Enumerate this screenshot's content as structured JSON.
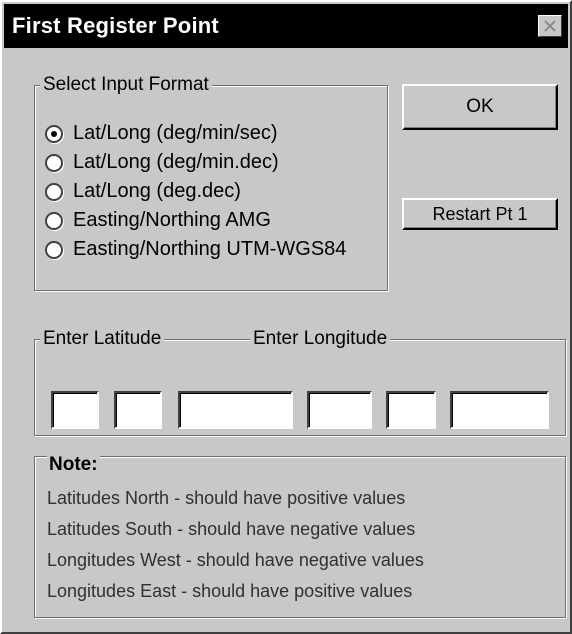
{
  "window": {
    "title": "First Register Point",
    "close_icon": "close-icon"
  },
  "input_format": {
    "legend": "Select Input Format",
    "selected": "Lat/Long (deg/min/sec)",
    "options": [
      "Lat/Long (deg/min/sec)",
      "Lat/Long (deg/min.dec)",
      "Lat/Long (deg.dec)",
      "Easting/Northing AMG",
      "Easting/Northing UTM-WGS84"
    ]
  },
  "buttons": {
    "ok": "OK",
    "restart": "Restart Pt 1"
  },
  "coordinates": {
    "latitude_label": "Enter Latitude",
    "longitude_label": "Enter Longitude",
    "latitude_values": [
      "",
      "",
      ""
    ],
    "longitude_values": [
      "",
      "",
      ""
    ]
  },
  "note": {
    "title": "Note:",
    "lines": [
      "Latitudes North - should have positive values",
      "Latitudes South - should have negative values",
      "Longitudes West - should have negative values",
      "Longitudes East - should have positive values"
    ]
  }
}
